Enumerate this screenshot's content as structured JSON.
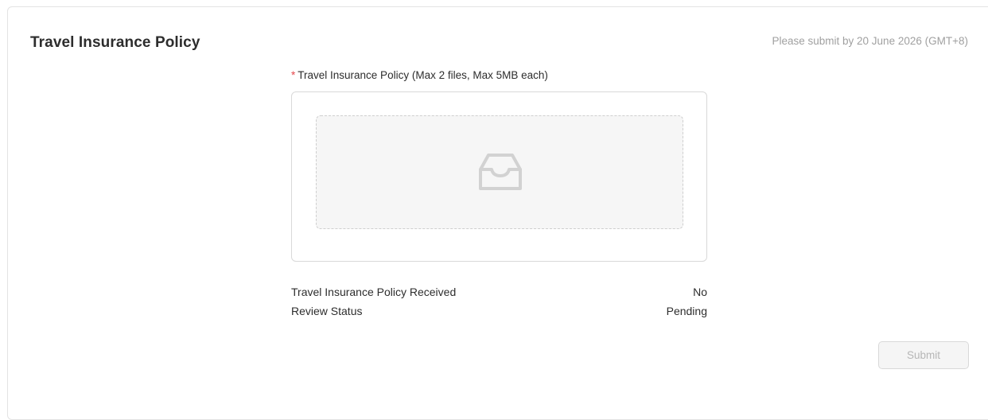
{
  "section": {
    "title": "Travel Insurance Policy",
    "deadline": "Please submit by 20 June 2026 (GMT+8)"
  },
  "upload": {
    "required_mark": "*",
    "label": "Travel Insurance Policy (Max 2 files, Max 5MB each)",
    "icon": "inbox-icon"
  },
  "info": {
    "received_label": "Travel Insurance Policy Received",
    "received_value": "No",
    "status_label": "Review Status",
    "status_value": "Pending"
  },
  "actions": {
    "submit_label": "Submit"
  },
  "colors": {
    "required": "#e5484d",
    "muted_text": "#a0a0a0",
    "disabled_text": "#b6b6b6",
    "border": "#d9d9d9"
  }
}
